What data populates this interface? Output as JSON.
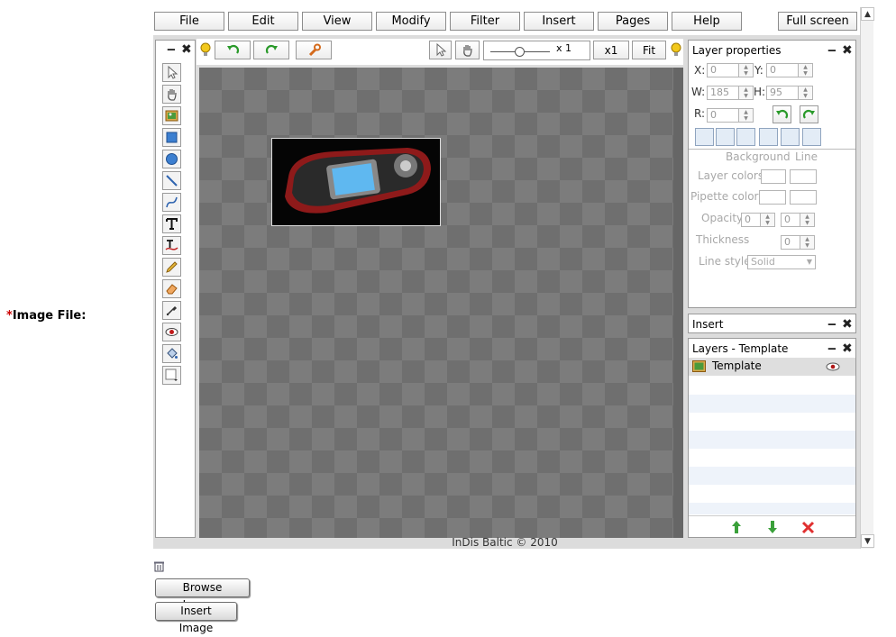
{
  "form": {
    "required_mark": "*",
    "label": "Image File:"
  },
  "menu": {
    "items": [
      "File",
      "Edit",
      "View",
      "Modify",
      "Filter",
      "Insert",
      "Pages",
      "Help"
    ],
    "fullscreen": "Full screen"
  },
  "toolbar": {
    "zoom_value": "x 1",
    "x1_label": "x1",
    "fit_label": "Fit"
  },
  "layer_properties": {
    "title": "Layer properties",
    "x_label": "X:",
    "x_value": "0",
    "y_label": "Y:",
    "y_value": "0",
    "w_label": "W:",
    "w_value": "185",
    "h_label": "H:",
    "h_value": "95",
    "r_label": "R:",
    "r_value": "0",
    "col_background": "Background",
    "col_line": "Line",
    "layer_colors": "Layer colors",
    "pipette_colors": "Pipette colors",
    "opacity": "Opacity",
    "opacity_bg": "0",
    "opacity_line": "0",
    "thickness": "Thickness",
    "thickness_value": "0",
    "line_style": "Line style",
    "line_style_value": "Solid"
  },
  "insert_panel": {
    "title": "Insert"
  },
  "layers_panel": {
    "title": "Layers - Template",
    "layers": [
      {
        "name": "Template"
      }
    ]
  },
  "footer": {
    "credit": "InDis Baltic © 2010"
  },
  "buttons": {
    "browse": "Browse Images",
    "insert": "Insert Image"
  },
  "colors": {
    "canvas_dark": "#6f6f6f",
    "canvas_light": "#7c7c7c",
    "align_buttons": "#e3ecf6",
    "required": "#cc0000"
  }
}
